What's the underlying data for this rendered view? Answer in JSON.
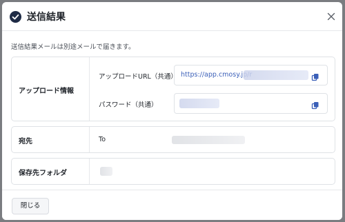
{
  "dialog": {
    "title": "送信結果",
    "notice": "送信結果メールは別途メールで届きます。"
  },
  "upload_info": {
    "label": "アップロード情報",
    "url_label": "アップロードURL（共通）",
    "url_value": "https://app.cmosy.jp/r",
    "password_label": "パスワード（共通）"
  },
  "recipient": {
    "label": "宛先",
    "to_label": "To"
  },
  "folder": {
    "label": "保存先フォルダ"
  },
  "footer": {
    "close_label": "閉じる"
  },
  "icons": {
    "title": "check-circle-icon",
    "close": "close-icon",
    "copy": "copy-icon"
  },
  "colors": {
    "accent": "#1e2b45",
    "link": "#3a5fb8"
  }
}
